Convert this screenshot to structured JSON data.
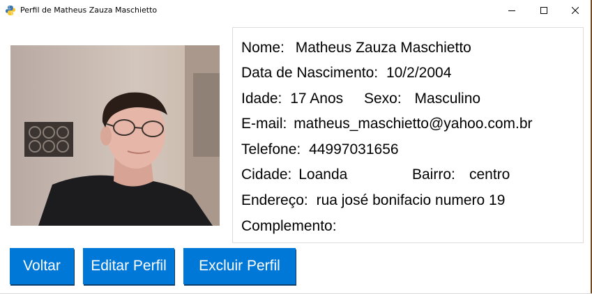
{
  "window": {
    "title": "Perfil de Matheus Zauza Maschietto",
    "app_icon": "python-icon",
    "controls": [
      "minimize-icon",
      "maximize-icon",
      "close-icon"
    ]
  },
  "profile": {
    "photo": "profile-photo",
    "name_label": "Nome:",
    "name_value": "Matheus Zauza Maschietto",
    "birth_label": "Data de Nascimento:",
    "birth_value": "10/2/2004",
    "age_label": "Idade:",
    "age_value": "17 Anos",
    "sex_label": "Sexo:",
    "sex_value": "Masculino",
    "email_label": "E-mail:",
    "email_value": "matheus_maschietto@yahoo.com.br",
    "phone_label": "Telefone:",
    "phone_value": "44997031656",
    "city_label": "Cidade:",
    "city_value": "Loanda",
    "district_label": "Bairro:",
    "district_value": "centro",
    "address_label": "Endereço:",
    "address_value": "rua josé bonifacio numero 19",
    "complement_label": "Complemento:",
    "complement_value": ""
  },
  "buttons": {
    "back": "Voltar",
    "edit": "Editar Perfil",
    "delete": "Excluir Perfil"
  },
  "colors": {
    "button_bg": "#0078d7",
    "button_text": "#ffffff"
  }
}
